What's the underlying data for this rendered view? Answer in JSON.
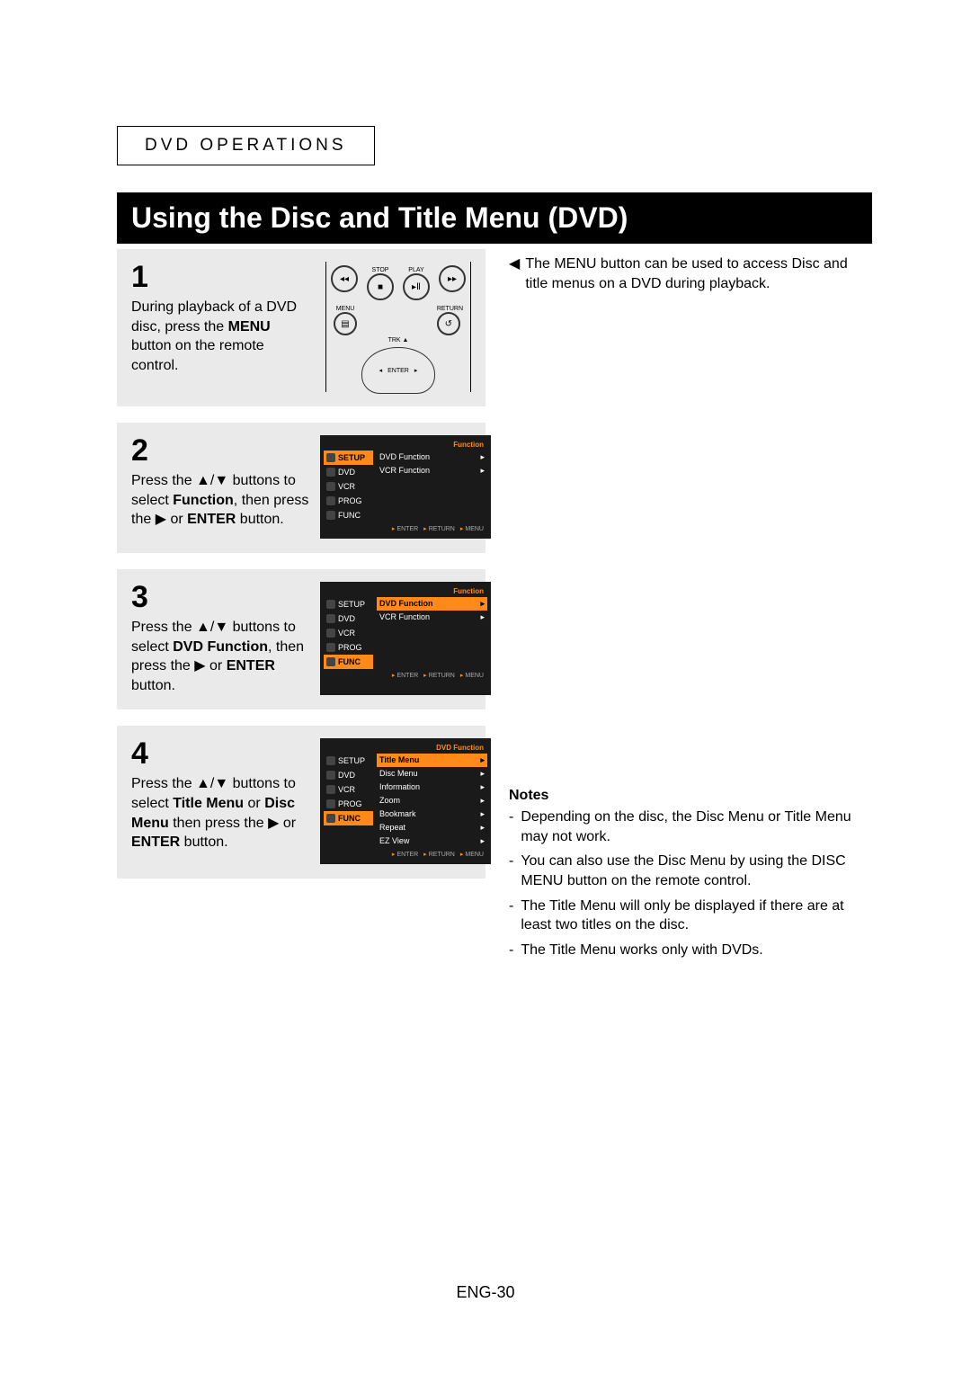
{
  "header": {
    "section": "DVD OPERATIONS"
  },
  "title": "Using the Disc and Title Menu (DVD)",
  "steps": {
    "s1": {
      "num": "1",
      "text_pre": "During playback of a DVD disc, press the ",
      "text_bold": "MENU",
      "text_post": " button on the remote control.",
      "remote": {
        "stop": "STOP",
        "play": "PLAY",
        "menu": "MENU",
        "return": "RETURN",
        "trk": "TRK ▲",
        "enter": "ENTER"
      }
    },
    "s2": {
      "num": "2",
      "text_pre": "Press the ▲/▼ buttons to select ",
      "text_bold": "Function",
      "text_mid": ", then press the ▶ or ",
      "text_bold2": "ENTER",
      "text_post": " button.",
      "osd": {
        "head": "Function",
        "side": [
          "SETUP",
          "DVD",
          "VCR",
          "PROG",
          "FUNC"
        ],
        "side_hl": 0,
        "main": [
          "DVD Function",
          "VCR Function"
        ],
        "main_hl": -1,
        "foot": [
          "ENTER",
          "RETURN",
          "MENU"
        ]
      }
    },
    "s3": {
      "num": "3",
      "text_pre": "Press the ▲/▼ buttons to select ",
      "text_bold": "DVD Function",
      "text_mid": ", then press the ▶ or ",
      "text_bold2": "ENTER",
      "text_post": " button.",
      "osd": {
        "head": "Function",
        "side": [
          "SETUP",
          "DVD",
          "VCR",
          "PROG",
          "FUNC"
        ],
        "side_hl": 4,
        "main": [
          "DVD Function",
          "VCR Function"
        ],
        "main_hl": 0,
        "foot": [
          "ENTER",
          "RETURN",
          "MENU"
        ]
      }
    },
    "s4": {
      "num": "4",
      "text_pre": "Press the ▲/▼ buttons to select ",
      "text_bold": "Title Menu",
      "text_mid": " or ",
      "text_bold2": "Disc Menu",
      "text_mid2": " then press the ▶ or ",
      "text_bold3": "ENTER",
      "text_post": " button.",
      "osd": {
        "head": "DVD Function",
        "side": [
          "SETUP",
          "DVD",
          "VCR",
          "PROG",
          "FUNC"
        ],
        "side_hl": 4,
        "main": [
          "Title Menu",
          "Disc Menu",
          "Information",
          "Zoom",
          "Bookmark",
          "Repeat",
          "EZ View"
        ],
        "main_hl": 0,
        "foot": [
          "ENTER",
          "RETURN",
          "MENU"
        ]
      }
    }
  },
  "tip": "The MENU button can be used to access Disc and title menus on a DVD during playback.",
  "notes_title": "Notes",
  "notes": [
    "Depending on the disc, the Disc Menu or Title Menu may not work.",
    "You can also use the Disc Menu by using the DISC MENU button on the remote control.",
    "The Title Menu will only be displayed if there are at least two titles on the disc.",
    "The Title Menu works only with DVDs."
  ],
  "pagenum": "ENG-30"
}
